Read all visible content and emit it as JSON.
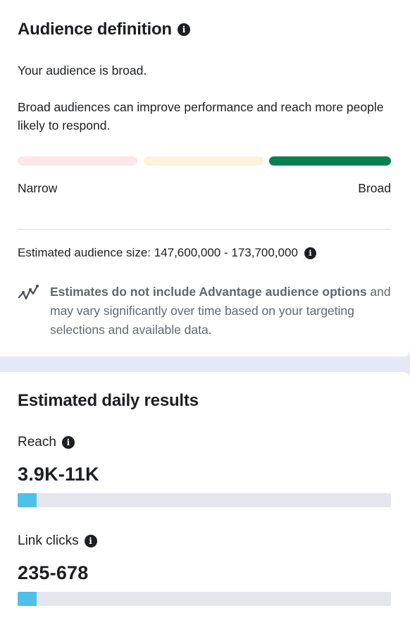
{
  "audience_definition": {
    "title": "Audience definition",
    "status": "Your audience is broad.",
    "description": "Broad audiences can improve performance and reach more people likely to respond.",
    "meter": {
      "left_label": "Narrow",
      "right_label": "Broad",
      "active_segment": "broad",
      "colors": {
        "narrow": "#fde2e4",
        "specific": "#fdf1d8",
        "broad": "#0a8050"
      }
    },
    "estimated_size_label": "Estimated audience size: 147,600,000 - 173,700,000",
    "note_bold": "Estimates do not include Advantage audience options",
    "note_rest": " and may vary significantly over time based on your targeting selections and available data."
  },
  "daily_results": {
    "title": "Estimated daily results",
    "reach": {
      "label": "Reach",
      "value": "3.9K-11K",
      "fill_fraction": 0.05
    },
    "link_clicks": {
      "label": "Link clicks",
      "value": "235-678",
      "fill_fraction": 0.05
    },
    "bar_color": "#4ec1e8"
  }
}
